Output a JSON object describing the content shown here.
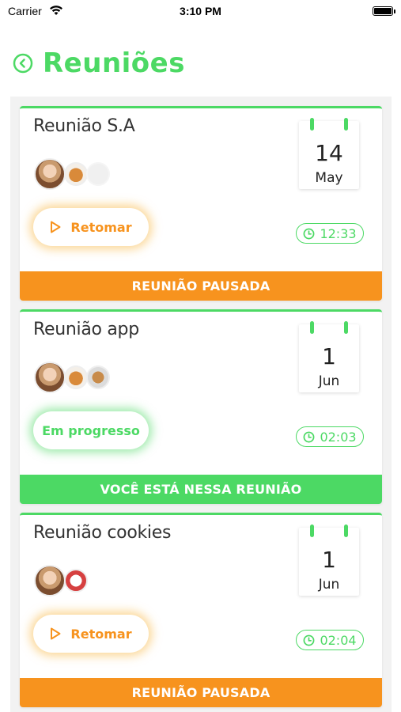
{
  "status_bar": {
    "carrier": "Carrier",
    "time": "3:10 PM"
  },
  "header": {
    "title": "Reuniões",
    "back_icon": "chevron-left-circle-icon"
  },
  "colors": {
    "accent_green": "#4cd964",
    "paused_orange": "#f7931e"
  },
  "meetings": [
    {
      "name": "Reunião S.A",
      "day": "14",
      "month": "May",
      "action_label": "Retomar",
      "action_icon": "play-icon",
      "timer": "12:33",
      "banner": "REUNIÃO PAUSADA",
      "state": "paused",
      "participants": [
        "person",
        "dog",
        "blank"
      ]
    },
    {
      "name": "Reunião app",
      "day": "1",
      "month": "Jun",
      "action_label": "Em progresso",
      "timer": "02:03",
      "banner": "VOCÊ ESTÁ NESSA REUNIÃO",
      "state": "live",
      "participants": [
        "person",
        "dog",
        "dog"
      ]
    },
    {
      "name": "Reunião cookies",
      "day": "1",
      "month": "Jun",
      "action_label": "Retomar",
      "action_icon": "play-icon",
      "timer": "02:04",
      "banner": "REUNIÃO PAUSADA",
      "state": "paused",
      "participants": [
        "person",
        "dog"
      ]
    }
  ]
}
